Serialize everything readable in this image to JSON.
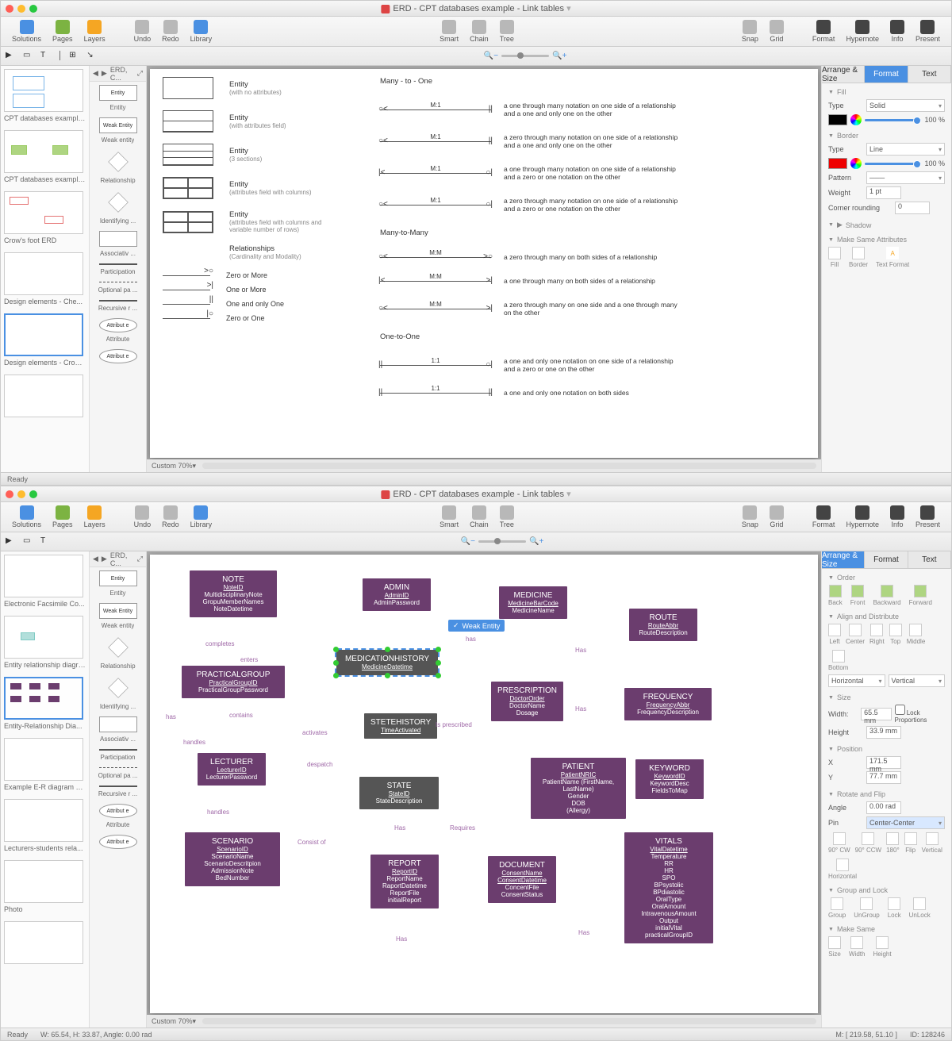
{
  "window_title": "ERD - CPT databases example - Link tables",
  "toolbar": {
    "solutions": "Solutions",
    "pages": "Pages",
    "layers": "Layers",
    "undo": "Undo",
    "redo": "Redo",
    "library": "Library",
    "smart": "Smart",
    "chain": "Chain",
    "tree": "Tree",
    "snap": "Snap",
    "grid": "Grid",
    "format": "Format",
    "hypernote": "Hypernote",
    "info": "Info",
    "present": "Present"
  },
  "breadcrumb": "ERD, C...",
  "thumbs_top": [
    "CPT databases example ...",
    "CPT databases example...",
    "Crow's foot ERD",
    "Design elements - Che...",
    "Design elements - Crow..."
  ],
  "thumbs_bot": [
    "Electronic Facsimile Co...",
    "Entity relationship diagram",
    "Entity-Relationship Dia...",
    "Example E-R diagram e...",
    "Lecturers-students rela...",
    "Photo"
  ],
  "lib": [
    "Entity",
    "Weak entity",
    "Relationship",
    "Identifying ...",
    "Associativ ...",
    "Participation",
    "Optional pa ...",
    "Recursive r ...",
    "Attribute"
  ],
  "legend": {
    "entities": [
      {
        "t": "Entity",
        "s": "(with no attributes)"
      },
      {
        "t": "Entity",
        "s": "(with attributes field)"
      },
      {
        "t": "Entity",
        "s": "(3 sections)"
      },
      {
        "t": "Entity",
        "s": "(attributes field with columns)"
      },
      {
        "t": "Entity",
        "s": "(attributes field with columns and variable number of rows)"
      }
    ],
    "cardinality": {
      "title": "Relationships",
      "sub": "(Cardinality and Modality)",
      "items": [
        "Zero or More",
        "One or More",
        "One and only One",
        "Zero or One"
      ]
    },
    "relations": [
      {
        "h": "Many - to - One"
      },
      {
        "n": "M:1",
        "d": "a one through many notation on one side of a relationship and a one and only one on the other"
      },
      {
        "n": "M:1",
        "d": "a zero through many notation on one side of a relationship and a one and only one on the other"
      },
      {
        "n": "M:1",
        "d": "a one through many notation on one side of a relationship and a zero or one notation on the other"
      },
      {
        "n": "M:1",
        "d": "a zero through many notation on one side of a relationship and a zero or one notation on the other"
      },
      {
        "h": "Many-to-Many"
      },
      {
        "n": "M:M",
        "d": "a zero through many on both sides of a relationship"
      },
      {
        "n": "M:M",
        "d": "a one through many on both sides of a relationship"
      },
      {
        "n": "M:M",
        "d": "a zero through many on one side and a one through many on the other"
      },
      {
        "h": "One-to-One"
      },
      {
        "n": "1:1",
        "d": "a one and only one notation on one side of a relationship and a zero or one on the other"
      },
      {
        "n": "1:1",
        "d": "a one and only one notation on both sides"
      }
    ]
  },
  "format_panel": {
    "tabs": [
      "Arrange & Size",
      "Format",
      "Text"
    ],
    "fill": {
      "hdr": "Fill",
      "type_lbl": "Type",
      "type_val": "Solid",
      "pct": "100 %"
    },
    "border": {
      "hdr": "Border",
      "type_lbl": "Type",
      "type_val": "Line",
      "pct": "100 %",
      "pattern": "Pattern",
      "weight_lbl": "Weight",
      "weight_val": "1 pt",
      "corner_lbl": "Corner rounding",
      "corner_val": "0"
    },
    "shadow": "Shadow",
    "make_same": {
      "hdr": "Make Same Attributes",
      "items": [
        "Fill",
        "Border",
        "Text Format"
      ]
    }
  },
  "arrange_panel": {
    "tabs": [
      "Arrange & Size",
      "Format",
      "Text"
    ],
    "order": {
      "hdr": "Order",
      "items": [
        "Back",
        "Front",
        "Backward",
        "Forward"
      ]
    },
    "align": {
      "hdr": "Align and Distribute",
      "items": [
        "Left",
        "Center",
        "Right",
        "Top",
        "Middle",
        "Bottom"
      ],
      "dist": [
        "Horizontal",
        "Vertical"
      ]
    },
    "size": {
      "hdr": "Size",
      "w_lbl": "Width:",
      "w_val": "65.5 mm",
      "h_lbl": "Height",
      "h_val": "33.9 mm",
      "lock": "Lock Proportions"
    },
    "position": {
      "hdr": "Position",
      "x_lbl": "X",
      "x_val": "171.5 mm",
      "y_lbl": "Y",
      "y_val": "77.7 mm"
    },
    "rotate": {
      "hdr": "Rotate and Flip",
      "angle_lbl": "Angle",
      "angle_val": "0.00 rad",
      "pin_lbl": "Pin",
      "pin_val": "Center-Center",
      "items": [
        "90° CW",
        "90° CCW",
        "180°",
        "Flip",
        "Vertical",
        "Horizontal"
      ]
    },
    "group": {
      "hdr": "Group and Lock",
      "items": [
        "Group",
        "UnGroup",
        "Lock",
        "UnLock"
      ]
    },
    "make_same": {
      "hdr": "Make Same",
      "items": [
        "Size",
        "Width",
        "Height"
      ]
    }
  },
  "zoom": "Custom 70%",
  "status_top": "Ready",
  "status_bot": {
    "ready": "Ready",
    "w": "W: 65.54,  H: 33.87,   Angle: 0.00 rad",
    "m": "M: [ 219.58, 51.10 ]",
    "id": "ID: 128246"
  },
  "tooltip": "Weak Entity",
  "erd": {
    "note": {
      "t": "NOTE",
      "f": [
        "NoteID",
        "MultidisciplinaryNote",
        "GropuMemberNames",
        "NoteDatetime"
      ]
    },
    "admin": {
      "t": "ADMIN",
      "f": [
        "AdminID",
        "AdminPassword"
      ]
    },
    "medicine": {
      "t": "MEDICINE",
      "f": [
        "MedicineBarCode",
        "MedicineName"
      ]
    },
    "route": {
      "t": "ROUTE",
      "f": [
        "RouteAbbr",
        "RouteDescription"
      ]
    },
    "practicalgroup": {
      "t": "PRACTICALGROUP",
      "f": [
        "PracticalGroupID",
        "PracticalGroupPassword"
      ]
    },
    "medicationhistory": {
      "t": "MEDICATIONHISTORY",
      "f": [
        "MedicineDatetime"
      ]
    },
    "prescription": {
      "t": "PRESCRIPTION",
      "f": [
        "DoctorOrder",
        "DoctorName",
        "Dosage"
      ]
    },
    "frequency": {
      "t": "FREQUENCY",
      "f": [
        "FrequencyAbbr",
        "FrequencyDescription"
      ]
    },
    "lecturer": {
      "t": "LECTURER",
      "f": [
        "LecturerID",
        "LecturerPassword"
      ]
    },
    "stetehistory": {
      "t": "STETEHISTORY",
      "f": [
        "TimeActivated"
      ]
    },
    "state": {
      "t": "STATE",
      "f": [
        "StateID",
        "StateDescription"
      ]
    },
    "patient": {
      "t": "PATIENT",
      "f": [
        "PatientNRIC",
        "PatientName (FirstName, LastName)",
        "Gender",
        "DOB",
        "(Allergy)"
      ]
    },
    "keyword": {
      "t": "KEYWORD",
      "f": [
        "KeywordID",
        "KeywordDesc",
        "FieldsToMap"
      ]
    },
    "scenario": {
      "t": "SCENARIO",
      "f": [
        "ScenarioID",
        "ScenarioName",
        "ScenarioDescritpion",
        "AdmissionNote",
        "BedNumber"
      ]
    },
    "report": {
      "t": "REPORT",
      "f": [
        "ReportID",
        "ReportName",
        "RaportDatetime",
        "ReportFile",
        "initialReport"
      ]
    },
    "document": {
      "t": "DOCUMENT",
      "f": [
        "ConsentName",
        "ConsentDatetime",
        "ConcentFile",
        "ConsentStatus"
      ]
    },
    "vitals": {
      "t": "VITALS",
      "f": [
        "VitalDatetime",
        "Temperature",
        "RR",
        "HR",
        "SPO",
        "BPsystolic",
        "BPdiastolic",
        "OralType",
        "OralAmount",
        "IntravenousAmount",
        "Output",
        "initialVital",
        "practicalGroupID"
      ]
    }
  },
  "rels": {
    "completes": "completes",
    "has": "has",
    "enters": "enters",
    "contains": "contains",
    "handles": "handles",
    "activates": "activates",
    "despatch": "despatch",
    "consist_of": "Consist of",
    "requires": "Requires",
    "is_prescribed": "Is prescribed",
    "Has": "Has"
  }
}
